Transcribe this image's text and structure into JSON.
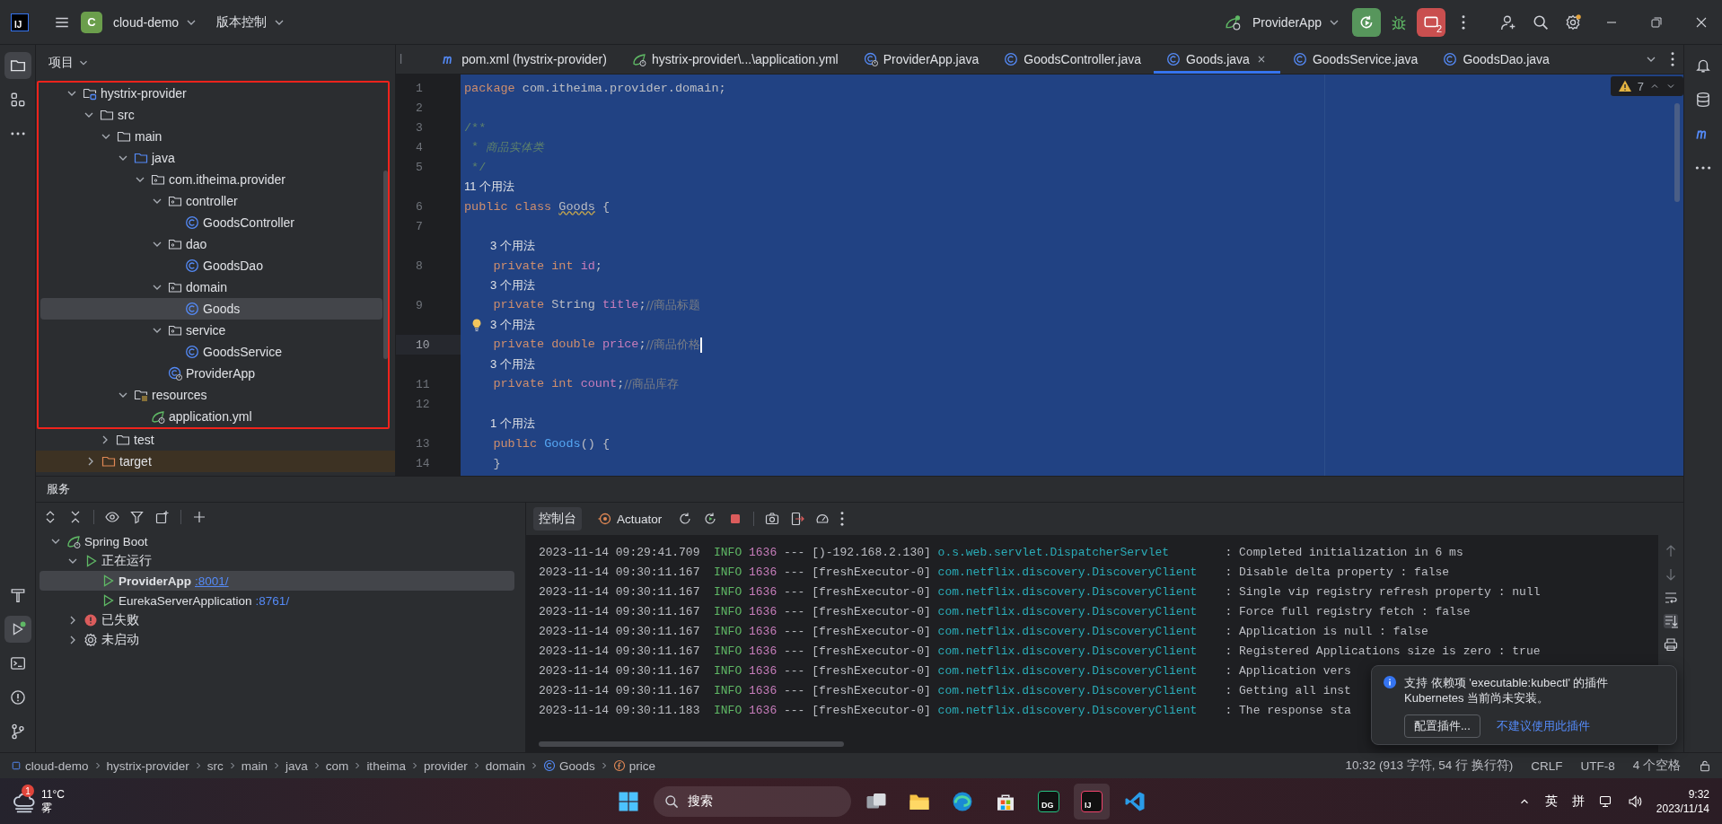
{
  "titlebar": {
    "logo": "IJ",
    "project_badge": "C",
    "project": "cloud-demo",
    "vcs": "版本控制",
    "run_config": "ProviderApp",
    "stop_count": "2"
  },
  "project_panel": {
    "title": "项目",
    "tree": [
      {
        "label": "hystrix-provider",
        "kind": "module",
        "expanded": true,
        "selected": false,
        "children": [
          {
            "label": "src",
            "kind": "folder",
            "expanded": true,
            "selected": false,
            "children": [
              {
                "label": "main",
                "kind": "folder",
                "expanded": true,
                "selected": false,
                "children": [
                  {
                    "label": "java",
                    "kind": "source",
                    "expanded": true,
                    "selected": false,
                    "children": [
                      {
                        "label": "com.itheima.provider",
                        "kind": "package",
                        "expanded": true,
                        "selected": false,
                        "children": [
                          {
                            "label": "controller",
                            "kind": "package",
                            "expanded": true,
                            "selected": false,
                            "children": [
                              {
                                "label": "GoodsController",
                                "kind": "class",
                                "selected": false
                              }
                            ]
                          },
                          {
                            "label": "dao",
                            "kind": "package",
                            "expanded": true,
                            "selected": false,
                            "children": [
                              {
                                "label": "GoodsDao",
                                "kind": "class",
                                "selected": false
                              }
                            ]
                          },
                          {
                            "label": "domain",
                            "kind": "package",
                            "expanded": true,
                            "selected": false,
                            "children": [
                              {
                                "label": "Goods",
                                "kind": "class",
                                "selected": true
                              }
                            ]
                          },
                          {
                            "label": "service",
                            "kind": "package",
                            "expanded": true,
                            "selected": false,
                            "children": [
                              {
                                "label": "GoodsService",
                                "kind": "class",
                                "selected": false
                              }
                            ]
                          },
                          {
                            "label": "ProviderApp",
                            "kind": "main-class",
                            "selected": false
                          }
                        ]
                      }
                    ]
                  },
                  {
                    "label": "resources",
                    "kind": "resources",
                    "expanded": true,
                    "selected": false,
                    "children": [
                      {
                        "label": "application.yml",
                        "kind": "yaml",
                        "selected": false
                      }
                    ]
                  }
                ]
              },
              {
                "label": "test",
                "kind": "folder",
                "expanded": false,
                "selected": false
              }
            ]
          },
          {
            "label": "target",
            "kind": "excluded",
            "expanded": false,
            "selected": false
          }
        ]
      }
    ]
  },
  "editor_tabs": [
    {
      "label": "l",
      "kind": "cut",
      "selected": false
    },
    {
      "label": "pom.xml (hystrix-provider)",
      "kind": "pom",
      "selected": false
    },
    {
      "label": "hystrix-provider\\...\\application.yml",
      "kind": "yaml",
      "selected": false
    },
    {
      "label": "ProviderApp.java",
      "kind": "main-class",
      "selected": false
    },
    {
      "label": "GoodsController.java",
      "kind": "class",
      "selected": false
    },
    {
      "label": "Goods.java",
      "kind": "class",
      "selected": true
    },
    {
      "label": "GoodsService.java",
      "kind": "class",
      "selected": false
    },
    {
      "label": "GoodsDao.java",
      "kind": "class",
      "selected": false
    }
  ],
  "inspections": {
    "count": "7"
  },
  "code": [
    {
      "n": "1",
      "current": false,
      "bulb": false,
      "tokens": [
        {
          "kind": "kw",
          "text": "package "
        },
        {
          "kind": "plain",
          "text": "com.itheima.provider.domain;"
        }
      ]
    },
    {
      "n": "2",
      "current": false,
      "bulb": false
    },
    {
      "n": "3",
      "current": false,
      "bulb": false,
      "tokens": [
        {
          "kind": "doc",
          "text": "/**"
        }
      ]
    },
    {
      "n": "4",
      "current": false,
      "bulb": false,
      "tokens": [
        {
          "kind": "doc",
          "text": " * "
        },
        {
          "kind": "docit",
          "text": "商品实体类"
        }
      ]
    },
    {
      "n": "5",
      "current": false,
      "bulb": false,
      "tokens": [
        {
          "kind": "doc",
          "text": " */"
        }
      ]
    },
    {
      "n": "6",
      "current": false,
      "bulb": false,
      "hint": "11 个用法",
      "tokens": [
        {
          "kind": "kw",
          "text": "public class "
        },
        {
          "kind": "warn",
          "text": "Goods"
        },
        {
          "kind": "plain",
          "text": " {"
        }
      ]
    },
    {
      "n": "7",
      "current": false,
      "bulb": false
    },
    {
      "n": "8",
      "current": false,
      "bulb": false,
      "hint": "3 个用法",
      "tokens": [
        {
          "kind": "kw",
          "text": "    private int "
        },
        {
          "kind": "field",
          "text": "id"
        },
        {
          "kind": "plain",
          "text": ";"
        }
      ]
    },
    {
      "n": "9",
      "current": false,
      "bulb": false,
      "hint": "3 个用法",
      "tokens": [
        {
          "kind": "kw",
          "text": "    private "
        },
        {
          "kind": "plain",
          "text": "String "
        },
        {
          "kind": "field",
          "text": "title"
        },
        {
          "kind": "plain",
          "text": ";"
        },
        {
          "kind": "comment",
          "text": "//商品标题"
        }
      ]
    },
    {
      "n": "10",
      "current": true,
      "bulb": true,
      "hint": "3 个用法",
      "tokens": [
        {
          "kind": "kw",
          "text": "    private double "
        },
        {
          "kind": "field",
          "text": "price"
        },
        {
          "kind": "plain",
          "text": ";"
        },
        {
          "kind": "comment",
          "text": "//商品价格"
        }
      ]
    },
    {
      "n": "11",
      "current": false,
      "bulb": false,
      "hint": "3 个用法",
      "tokens": [
        {
          "kind": "kw",
          "text": "    private int "
        },
        {
          "kind": "field",
          "text": "count"
        },
        {
          "kind": "plain",
          "text": ";"
        },
        {
          "kind": "comment",
          "text": "//商品库存"
        }
      ]
    },
    {
      "n": "12",
      "current": false,
      "bulb": false
    },
    {
      "n": "13",
      "current": false,
      "bulb": false,
      "hint": "1 个用法",
      "tokens": [
        {
          "kind": "kw",
          "text": "    public "
        },
        {
          "kind": "method",
          "text": "Goods"
        },
        {
          "kind": "plain",
          "text": "() {"
        }
      ]
    },
    {
      "n": "14",
      "current": false,
      "bulb": false,
      "tokens": [
        {
          "kind": "plain",
          "text": "    }"
        }
      ]
    }
  ],
  "services": {
    "title": "服务",
    "tree": [
      {
        "label": "Spring Boot",
        "kind": "spring",
        "expanded": true,
        "selected": false,
        "children": [
          {
            "label": "正在运行",
            "kind": "running",
            "expanded": true,
            "selected": false,
            "children": [
              {
                "label": "ProviderApp",
                "port": ":8001/",
                "kind": "app",
                "selected": true
              },
              {
                "label": "EurekaServerApplication",
                "port": ":8761/",
                "kind": "app",
                "selected": false
              }
            ]
          },
          {
            "label": "已失败",
            "kind": "failed",
            "expanded": false,
            "selected": false
          },
          {
            "label": "未启动",
            "kind": "idle",
            "expanded": false,
            "selected": false
          }
        ]
      }
    ]
  },
  "console": {
    "tabs": [
      {
        "label": "控制台",
        "kind": "console",
        "selected": true
      },
      {
        "label": "Actuator",
        "kind": "actuator",
        "selected": false
      }
    ],
    "lines": [
      {
        "ts": "2023-11-14 09:29:41.709",
        "level": "INFO",
        "pid": "1636",
        "sep": "---",
        "thread": "[)-192.168.2.130]",
        "logger": "o.s.web.servlet.DispatcherServlet",
        "msg": ": Completed initialization in 6 ms"
      },
      {
        "ts": "2023-11-14 09:30:11.167",
        "level": "INFO",
        "pid": "1636",
        "sep": "---",
        "thread": "[freshExecutor-0]",
        "logger": "com.netflix.discovery.DiscoveryClient",
        "msg": ": Disable delta property : false"
      },
      {
        "ts": "2023-11-14 09:30:11.167",
        "level": "INFO",
        "pid": "1636",
        "sep": "---",
        "thread": "[freshExecutor-0]",
        "logger": "com.netflix.discovery.DiscoveryClient",
        "msg": ": Single vip registry refresh property : null"
      },
      {
        "ts": "2023-11-14 09:30:11.167",
        "level": "INFO",
        "pid": "1636",
        "sep": "---",
        "thread": "[freshExecutor-0]",
        "logger": "com.netflix.discovery.DiscoveryClient",
        "msg": ": Force full registry fetch : false"
      },
      {
        "ts": "2023-11-14 09:30:11.167",
        "level": "INFO",
        "pid": "1636",
        "sep": "---",
        "thread": "[freshExecutor-0]",
        "logger": "com.netflix.discovery.DiscoveryClient",
        "msg": ": Application is null : false"
      },
      {
        "ts": "2023-11-14 09:30:11.167",
        "level": "INFO",
        "pid": "1636",
        "sep": "---",
        "thread": "[freshExecutor-0]",
        "logger": "com.netflix.discovery.DiscoveryClient",
        "msg": ": Registered Applications size is zero : true"
      },
      {
        "ts": "2023-11-14 09:30:11.167",
        "level": "INFO",
        "pid": "1636",
        "sep": "---",
        "thread": "[freshExecutor-0]",
        "logger": "com.netflix.discovery.DiscoveryClient",
        "msg": ": Application vers"
      },
      {
        "ts": "2023-11-14 09:30:11.167",
        "level": "INFO",
        "pid": "1636",
        "sep": "---",
        "thread": "[freshExecutor-0]",
        "logger": "com.netflix.discovery.DiscoveryClient",
        "msg": ": Getting all inst"
      },
      {
        "ts": "2023-11-14 09:30:11.183",
        "level": "INFO",
        "pid": "1636",
        "sep": "---",
        "thread": "[freshExecutor-0]",
        "logger": "com.netflix.discovery.DiscoveryClient",
        "msg": ": The response sta"
      }
    ]
  },
  "notification": {
    "lines": [
      "支持 依赖项 'executable:kubectl' 的插件",
      "Kubernetes 当前尚未安装。"
    ],
    "button": "配置插件...",
    "link": "不建议使用此插件"
  },
  "right_toolbar": [
    {
      "kind": "bell"
    },
    {
      "kind": "database"
    },
    {
      "kind": "pom"
    },
    {
      "kind": "more"
    }
  ],
  "breadcrumbs": [
    {
      "label": "cloud-demo",
      "kind": "module"
    },
    {
      "label": "hystrix-provider",
      "kind": "plain"
    },
    {
      "label": "src",
      "kind": "plain"
    },
    {
      "label": "main",
      "kind": "plain"
    },
    {
      "label": "java",
      "kind": "plain"
    },
    {
      "label": "com",
      "kind": "plain"
    },
    {
      "label": "itheima",
      "kind": "plain"
    },
    {
      "label": "provider",
      "kind": "plain"
    },
    {
      "label": "domain",
      "kind": "plain"
    },
    {
      "label": "Goods",
      "kind": "class"
    },
    {
      "label": "price",
      "kind": "field"
    }
  ],
  "status_items": [
    "10:32 (913 字符, 54 行 换行符)",
    "CRLF",
    "UTF-8",
    "4 个空格"
  ],
  "taskbar": {
    "weather_badge": "1",
    "temperature": "11°C",
    "condition": "雾",
    "search": "搜索",
    "apps": [
      {
        "kind": "windows",
        "selected": false
      },
      {
        "kind": "search",
        "selected": false
      },
      {
        "kind": "taskview",
        "selected": false
      },
      {
        "kind": "explorer",
        "selected": false
      },
      {
        "kind": "edge",
        "selected": false
      },
      {
        "kind": "store",
        "selected": false
      },
      {
        "kind": "dg",
        "glyph": "DG",
        "selected": false
      },
      {
        "kind": "ij",
        "glyph": "IJ",
        "selected": true
      },
      {
        "kind": "vscode",
        "selected": false
      }
    ],
    "ime": [
      "英",
      "拼"
    ],
    "time": "9:32",
    "date": "2023/11/14"
  }
}
